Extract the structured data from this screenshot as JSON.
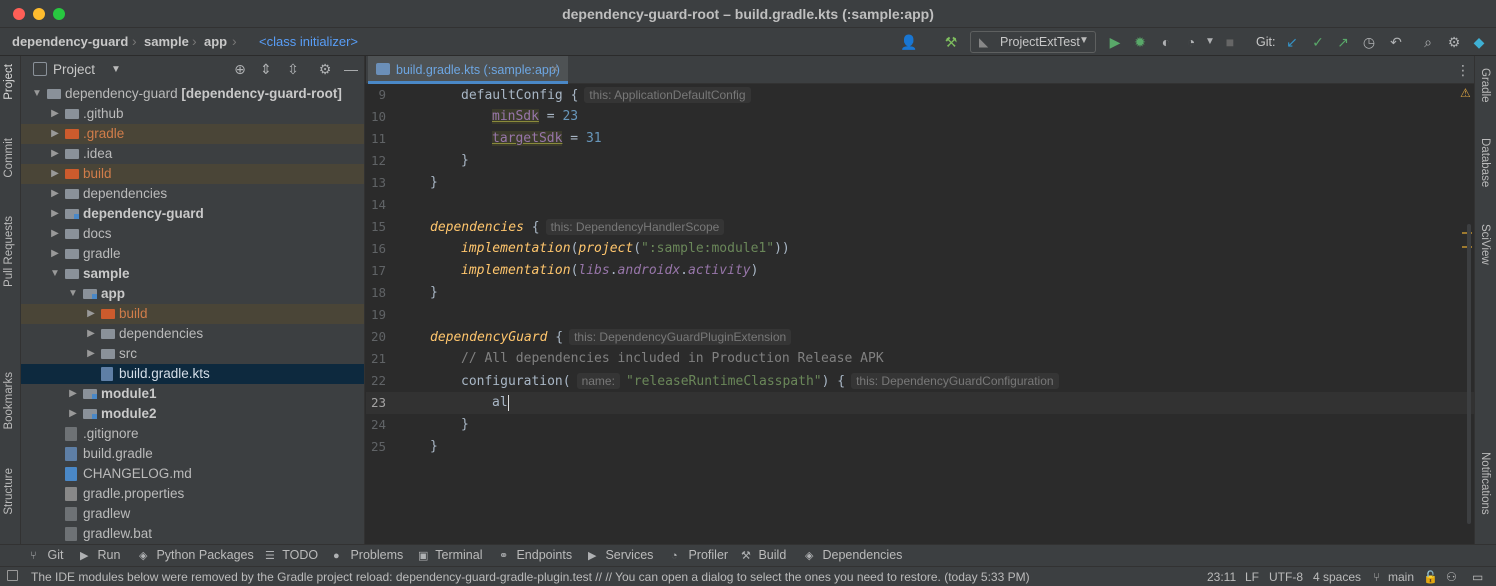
{
  "window": {
    "title": "dependency-guard-root – build.gradle.kts (:sample:app)"
  },
  "navbar": {
    "breadcrumbs": [
      "dependency-guard",
      "sample",
      "app"
    ],
    "class_crumb": "<class initializer>",
    "run_config": "ProjectExtTest",
    "git_label": "Git:"
  },
  "left_strip": {
    "tabs": [
      "Project",
      "Commit",
      "Pull Requests",
      "Bookmarks",
      "Structure"
    ]
  },
  "right_strip": {
    "tabs": [
      "Gradle",
      "Database",
      "SciView",
      "Notifications"
    ]
  },
  "project_panel": {
    "title": "Project",
    "tree": [
      {
        "label": "dependency-guard",
        "suffix": "[dependency-guard-root]",
        "depth": 0,
        "arrow": "open",
        "icon": "folder"
      },
      {
        "label": ".github",
        "depth": 1,
        "arrow": "closed",
        "icon": "folder"
      },
      {
        "label": ".gradle",
        "depth": 1,
        "arrow": "closed",
        "icon": "folder-orange",
        "excluded": true
      },
      {
        "label": ".idea",
        "depth": 1,
        "arrow": "closed",
        "icon": "folder"
      },
      {
        "label": "build",
        "depth": 1,
        "arrow": "closed",
        "icon": "folder-orange",
        "excluded": true
      },
      {
        "label": "dependencies",
        "depth": 1,
        "arrow": "closed",
        "icon": "folder"
      },
      {
        "label": "dependency-guard",
        "depth": 1,
        "arrow": "closed",
        "icon": "module",
        "bold": true
      },
      {
        "label": "docs",
        "depth": 1,
        "arrow": "closed",
        "icon": "folder"
      },
      {
        "label": "gradle",
        "depth": 1,
        "arrow": "closed",
        "icon": "folder"
      },
      {
        "label": "sample",
        "depth": 1,
        "arrow": "open",
        "icon": "folder",
        "bold": true
      },
      {
        "label": "app",
        "depth": 2,
        "arrow": "open",
        "icon": "module",
        "bold": true
      },
      {
        "label": "build",
        "depth": 3,
        "arrow": "closed",
        "icon": "folder-orange",
        "excluded": true
      },
      {
        "label": "dependencies",
        "depth": 3,
        "arrow": "closed",
        "icon": "folder"
      },
      {
        "label": "src",
        "depth": 3,
        "arrow": "closed",
        "icon": "folder"
      },
      {
        "label": "build.gradle.kts",
        "depth": 3,
        "arrow": "none",
        "icon": "gradle",
        "selected": true
      },
      {
        "label": "module1",
        "depth": 2,
        "arrow": "closed",
        "icon": "module",
        "bold": true
      },
      {
        "label": "module2",
        "depth": 2,
        "arrow": "closed",
        "icon": "module",
        "bold": true
      },
      {
        "label": ".gitignore",
        "depth": 1,
        "arrow": "none",
        "icon": "file"
      },
      {
        "label": "build.gradle",
        "depth": 1,
        "arrow": "none",
        "icon": "gradle"
      },
      {
        "label": "CHANGELOG.md",
        "depth": 1,
        "arrow": "none",
        "icon": "md"
      },
      {
        "label": "gradle.properties",
        "depth": 1,
        "arrow": "none",
        "icon": "props"
      },
      {
        "label": "gradlew",
        "depth": 1,
        "arrow": "none",
        "icon": "file"
      },
      {
        "label": "gradlew.bat",
        "depth": 1,
        "arrow": "none",
        "icon": "file"
      }
    ]
  },
  "editor": {
    "tab_label": "build.gradle.kts (:sample:app)",
    "lines": [
      {
        "n": "9",
        "indent": 1,
        "parts": [
          [
            "plain",
            "defaultConfig {"
          ],
          [
            "hint",
            "this: ApplicationDefaultConfig"
          ]
        ]
      },
      {
        "n": "10",
        "indent": 2,
        "parts": [
          [
            "warnu",
            "minSdk"
          ],
          [
            "plain",
            " = "
          ],
          [
            "num",
            "23"
          ]
        ]
      },
      {
        "n": "11",
        "indent": 2,
        "parts": [
          [
            "warnu",
            "targetSdk"
          ],
          [
            "plain",
            " = "
          ],
          [
            "num",
            "31"
          ]
        ]
      },
      {
        "n": "12",
        "indent": 1,
        "parts": [
          [
            "plain",
            "}"
          ]
        ]
      },
      {
        "n": "13",
        "indent": 0,
        "parts": [
          [
            "plain",
            "}"
          ]
        ]
      },
      {
        "n": "14",
        "indent": 0,
        "parts": []
      },
      {
        "n": "15",
        "indent": 0,
        "parts": [
          [
            "fn",
            "dependencies"
          ],
          [
            "plain",
            " {"
          ],
          [
            "hint",
            "this: DependencyHandlerScope"
          ]
        ]
      },
      {
        "n": "16",
        "indent": 1,
        "parts": [
          [
            "fn",
            "implementation"
          ],
          [
            "plain",
            "("
          ],
          [
            "fn",
            "project"
          ],
          [
            "plain",
            "("
          ],
          [
            "str",
            "\":sample:module1\""
          ],
          [
            "plain",
            "))"
          ]
        ]
      },
      {
        "n": "17",
        "indent": 1,
        "parts": [
          [
            "fn",
            "implementation"
          ],
          [
            "plain",
            "("
          ],
          [
            "prop",
            "libs"
          ],
          [
            "plain",
            "."
          ],
          [
            "prop",
            "androidx"
          ],
          [
            "plain",
            "."
          ],
          [
            "prop",
            "activity"
          ],
          [
            "plain",
            ")"
          ]
        ]
      },
      {
        "n": "18",
        "indent": 0,
        "parts": [
          [
            "plain",
            "}"
          ]
        ]
      },
      {
        "n": "19",
        "indent": 0,
        "parts": []
      },
      {
        "n": "20",
        "indent": 0,
        "parts": [
          [
            "fn",
            "dependencyGuard"
          ],
          [
            "plain",
            " {"
          ],
          [
            "hint",
            "this: DependencyGuardPluginExtension"
          ]
        ]
      },
      {
        "n": "21",
        "indent": 1,
        "parts": [
          [
            "cmt",
            "// All dependencies included in Production Release APK"
          ]
        ]
      },
      {
        "n": "22",
        "indent": 1,
        "parts": [
          [
            "plain",
            "configuration("
          ],
          [
            "hint",
            "name:"
          ],
          [
            "str",
            "\"releaseRuntimeClasspath\""
          ],
          [
            "plain",
            ") {"
          ],
          [
            "hint",
            "this: DependencyGuardConfiguration"
          ]
        ]
      },
      {
        "n": "23",
        "indent": 2,
        "parts": [
          [
            "plain",
            "al"
          ]
        ],
        "current": true
      },
      {
        "n": "24",
        "indent": 1,
        "parts": [
          [
            "plain",
            "}"
          ]
        ]
      },
      {
        "n": "25",
        "indent": 0,
        "parts": [
          [
            "plain",
            "}"
          ]
        ]
      }
    ]
  },
  "bottom_bar": {
    "tabs": [
      {
        "icon": "branch-icon",
        "glyph": "⑂",
        "label": "Git"
      },
      {
        "icon": "run-icon",
        "glyph": "▶",
        "label": "Run"
      },
      {
        "icon": "python-packages-icon",
        "glyph": "◈",
        "label": "Python Packages"
      },
      {
        "icon": "todo-icon",
        "glyph": "☰",
        "label": "TODO"
      },
      {
        "icon": "problems-icon",
        "glyph": "●",
        "label": "Problems"
      },
      {
        "icon": "terminal-icon",
        "glyph": "▣",
        "label": "Terminal"
      },
      {
        "icon": "endpoints-icon",
        "glyph": "⚭",
        "label": "Endpoints"
      },
      {
        "icon": "services-icon",
        "glyph": "▶",
        "label": "Services"
      },
      {
        "icon": "profiler-icon",
        "glyph": "◔",
        "label": "Profiler"
      },
      {
        "icon": "build-icon",
        "glyph": "⚒",
        "label": "Build"
      },
      {
        "icon": "dependencies-icon",
        "glyph": "◈",
        "label": "Dependencies"
      }
    ]
  },
  "status_bar": {
    "message": "The IDE modules below were removed by the Gradle project reload: dependency-guard-gradle-plugin.test // // You can open a dialog to select the ones you need to restore. (today 5:33 PM)",
    "position": "23:11",
    "line_sep": "LF",
    "encoding": "UTF-8",
    "indent": "4 spaces",
    "branch": "main"
  },
  "colors": {
    "accent": "#4a88c7",
    "keyword": "#cc7832",
    "function": "#ffc66d",
    "string": "#6a8759",
    "number": "#6897bb",
    "excluded_folder": "#cc5b2d"
  }
}
